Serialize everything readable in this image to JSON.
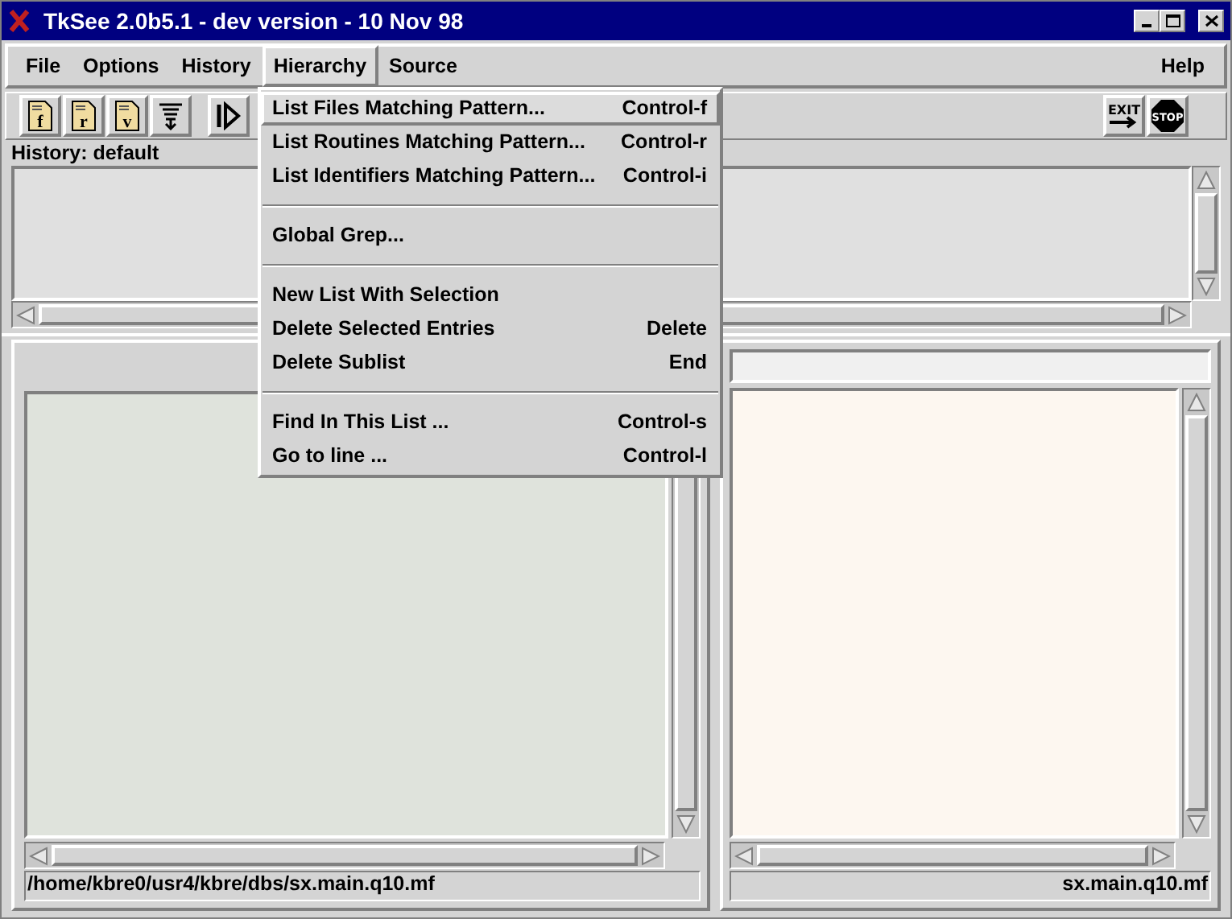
{
  "window": {
    "title": "TkSee 2.0b5.1 - dev version - 10 Nov 98"
  },
  "menubar": [
    {
      "label": "File",
      "selected": false
    },
    {
      "label": "Options",
      "selected": false
    },
    {
      "label": "History",
      "selected": false
    },
    {
      "label": "Hierarchy",
      "selected": true
    },
    {
      "label": "Source",
      "selected": false
    }
  ],
  "help_menu": "Help",
  "toolbar": {
    "left_buttons": [
      {
        "kind": "file",
        "letter": "f"
      },
      {
        "kind": "file",
        "letter": "r"
      },
      {
        "kind": "file",
        "letter": "v"
      },
      {
        "kind": "filter"
      },
      {
        "kind": "play"
      }
    ],
    "right_buttons": [
      {
        "kind": "exit",
        "label": "EXIT"
      },
      {
        "kind": "stop",
        "label": "STOP"
      }
    ]
  },
  "history": {
    "label": "History: default"
  },
  "menu": [
    {
      "kind": "item",
      "label": "List Files Matching Pattern...",
      "shortcut": "Control-f",
      "selected": true
    },
    {
      "kind": "item",
      "label": "List Routines Matching Pattern...",
      "shortcut": "Control-r",
      "selected": false
    },
    {
      "kind": "item",
      "label": "List Identifiers Matching Pattern...",
      "shortcut": "Control-i",
      "selected": false
    },
    {
      "kind": "separator"
    },
    {
      "kind": "item",
      "label": "Global Grep...",
      "selected": false
    },
    {
      "kind": "separator"
    },
    {
      "kind": "item",
      "label": "New List With Selection",
      "selected": false
    },
    {
      "kind": "item",
      "label": "Delete Selected Entries",
      "shortcut": "Delete",
      "selected": false
    },
    {
      "kind": "item",
      "label": "Delete Sublist",
      "shortcut": "End",
      "selected": false
    },
    {
      "kind": "separator"
    },
    {
      "kind": "item",
      "label": "Find In This List  ...",
      "shortcut": "Control-s",
      "selected": false
    },
    {
      "kind": "item",
      "label": "Go to line  ...",
      "shortcut": "Control-l",
      "selected": false
    }
  ],
  "status_bar": {
    "left": "/home/kbre0/usr4/kbre/dbs/sx.main.q10.mf",
    "right": "sx.main.q10.mf"
  }
}
